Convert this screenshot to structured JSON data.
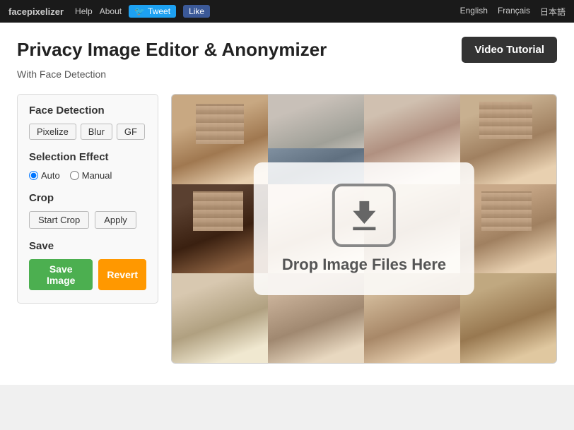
{
  "topnav": {
    "brand": "facepixelizer",
    "links": [
      "Help",
      "About"
    ],
    "tweet_label": "Tweet",
    "like_label": "Like",
    "languages": [
      "English",
      "Français",
      "日本語"
    ]
  },
  "header": {
    "title_part1": "Privacy Image Editor & ",
    "title_highlight": "Anonymizer",
    "video_button": "Video Tutorial",
    "subtitle": "With Face Detection"
  },
  "left_panel": {
    "face_detection_title": "Face Detection",
    "effect_buttons": [
      "Pixelize",
      "Blur",
      "GF"
    ],
    "selection_effect_title": "Selection Effect",
    "radio_auto": "Auto",
    "radio_manual": "Manual",
    "crop_title": "Crop",
    "start_crop_label": "Start Crop",
    "apply_label": "Apply",
    "save_title": "Save",
    "save_image_label": "Save Image",
    "revert_label": "Revert"
  },
  "dropzone": {
    "text": "Drop Image Files Here"
  }
}
